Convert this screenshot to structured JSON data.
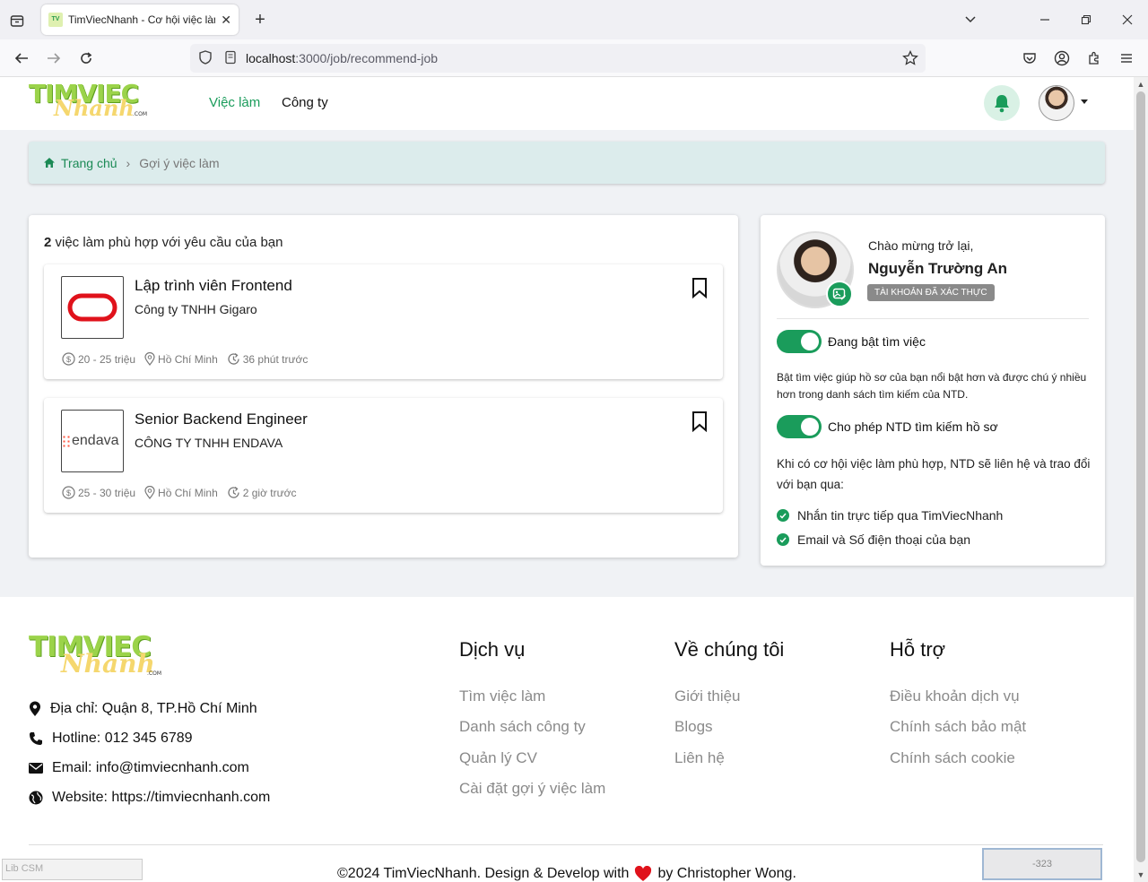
{
  "browser": {
    "tab_title": "TimViecNhanh - Cơ hội việc làm",
    "url_host": "localhost",
    "url_path": ":3000/job/recommend-job"
  },
  "header": {
    "logo_top": "TIMVIEC",
    "logo_script": "Nhanh",
    "logo_com": ".COM",
    "nav": [
      "Việc làm",
      "Công ty"
    ]
  },
  "breadcrumb": {
    "home": "Trang chủ",
    "current": "Gợi ý việc làm"
  },
  "jobs": {
    "count": "2",
    "count_text": " việc làm phù hợp với yêu cầu của bạn",
    "items": [
      {
        "title": "Lập trình viên Frontend",
        "company": "Công ty TNHH Gigaro",
        "salary": "20 - 25 triệu",
        "location": "Hồ Chí Minh",
        "posted": "36 phút trước"
      },
      {
        "title": "Senior Backend Engineer",
        "company": "CÔNG TY TNHH ENDAVA",
        "logo_text": "endava",
        "salary": "25 - 30 triệu",
        "location": "Hồ Chí Minh",
        "posted": "2 giờ trước"
      }
    ]
  },
  "profile": {
    "greeting": "Chào mừng trở lại,",
    "name": "Nguyễn Trường An",
    "verified": "TÀI KHOẢN ĐÃ XÁC THỰC",
    "toggle1_label": "Đang bật tìm việc",
    "toggle1_desc": "Bật tìm việc giúp hồ sơ của bạn nổi bật hơn và được chú ý nhiều hơn trong danh sách tìm kiếm của NTD.",
    "toggle2_label": "Cho phép NTD tìm kiếm hồ sơ",
    "toggle2_desc": "Khi có cơ hội việc làm phù hợp, NTD sẽ liên hệ và trao đổi với bạn qua:",
    "checks": [
      "Nhắn tin trực tiếp qua TimViecNhanh",
      "Email và Số điện thoại của bạn"
    ]
  },
  "footer": {
    "address": "Địa chỉ: Quận 8, TP.Hồ Chí Minh",
    "hotline": "Hotline: 012 345 6789",
    "email": "Email: info@timviecnhanh.com",
    "website": "Website: https://timviecnhanh.com",
    "col1_title": "Dịch vụ",
    "col1_links": [
      "Tìm việc làm",
      "Danh sách công ty",
      "Quản lý CV",
      "Cài đặt gợi ý việc làm"
    ],
    "col2_title": "Về chúng tôi",
    "col2_links": [
      "Giới thiệu",
      "Blogs",
      "Liên hệ"
    ],
    "col3_title": "Hỗ trợ",
    "col3_links": [
      "Điều khoản dịch vụ",
      "Chính sách bảo mật",
      "Chính sách cookie"
    ],
    "copyright_pre": "©2024 TimViecNhanh. Design & Develop with",
    "copyright_post": "by Christopher Wong."
  },
  "overlay": {
    "lib_csm": "Lib CSM",
    "counter": "-323"
  },
  "colors": {
    "accent": "#1a9c5b",
    "breadcrumb_bg": "#dcecec",
    "logo_green": "#9bd34a",
    "logo_yellow": "#f5d76e"
  }
}
